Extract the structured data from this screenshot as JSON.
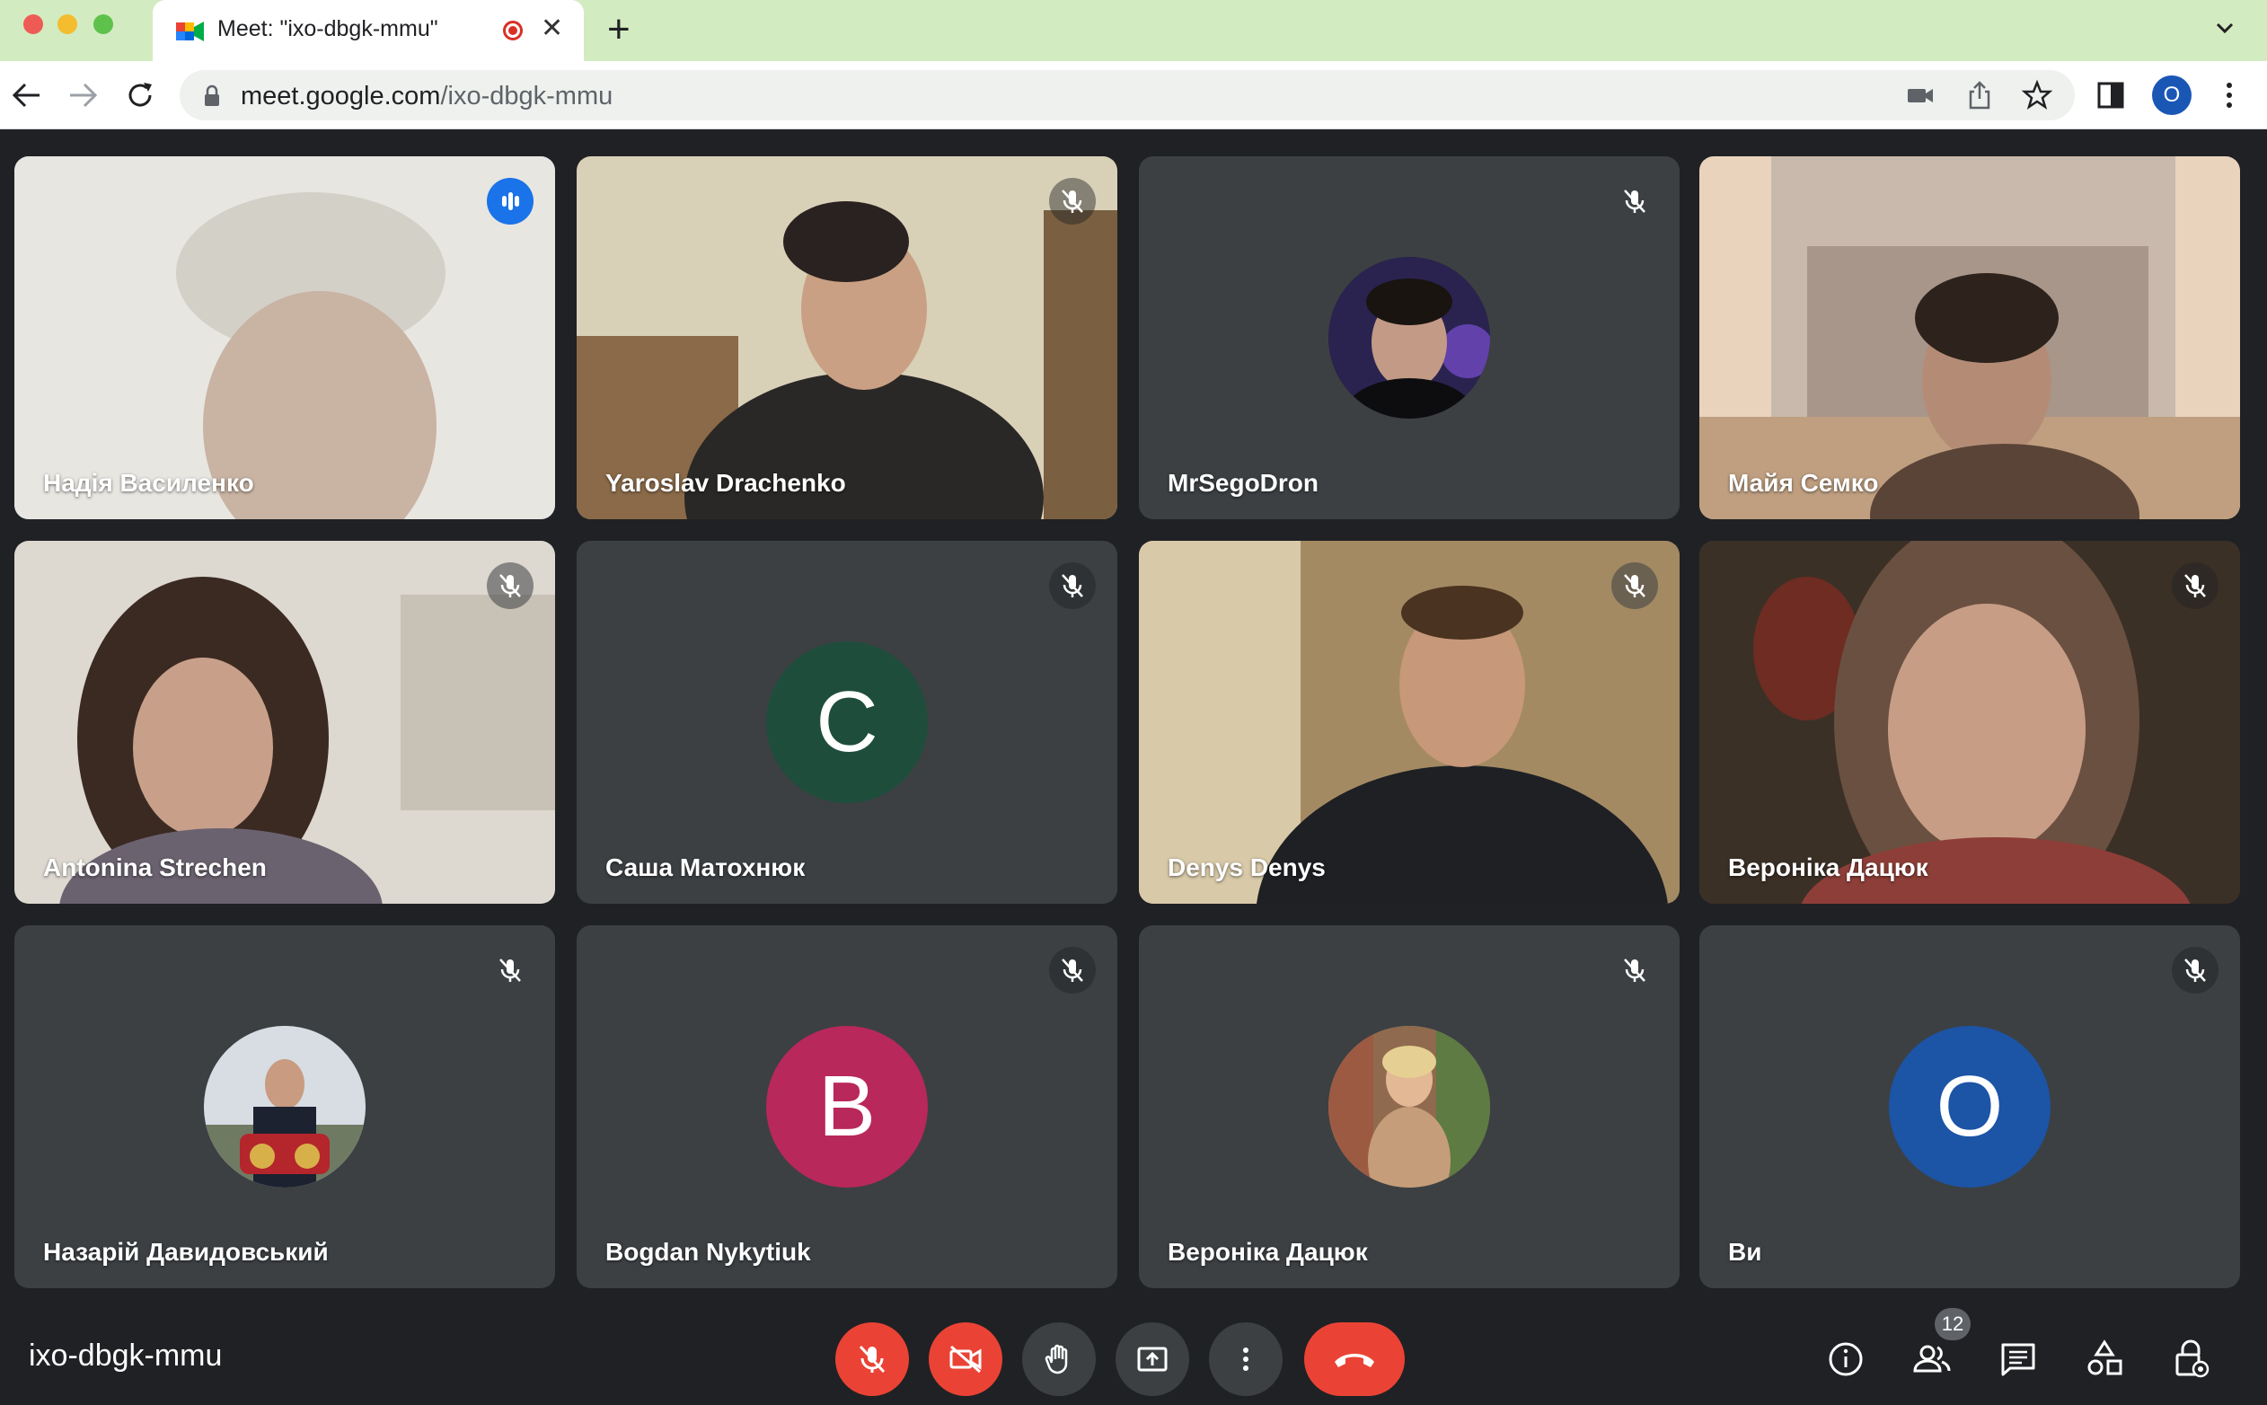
{
  "browser": {
    "tab_title": "Meet: \"ixo-dbgk-mmu\"",
    "close_symbol": "✕",
    "new_tab_symbol": "+",
    "url_host": "meet.google.com",
    "url_path": "/ixo-dbgk-mmu",
    "profile_initial": "O"
  },
  "participants": [
    {
      "name": "Надія Василенко",
      "state": "speaking",
      "view": "video"
    },
    {
      "name": "Yaroslav Drachenko",
      "state": "muted",
      "view": "video"
    },
    {
      "name": "MrSegoDron",
      "state": "muted",
      "view": "avatar-photo"
    },
    {
      "name": "Майя Семко",
      "state": "video",
      "view": "video"
    },
    {
      "name": "Antonina Strechen",
      "state": "muted",
      "view": "video"
    },
    {
      "name": "Саша Матохнюк",
      "state": "muted",
      "view": "avatar-initial",
      "initial": "С",
      "color": "#1e4d3b"
    },
    {
      "name": "Denys Denys",
      "state": "muted",
      "view": "video"
    },
    {
      "name": "Вероніка Дацюк",
      "state": "muted",
      "view": "video"
    },
    {
      "name": "Назарій Давидовський",
      "state": "muted",
      "view": "avatar-photo"
    },
    {
      "name": "Bogdan Nykytiuk",
      "state": "muted",
      "view": "avatar-initial",
      "initial": "B",
      "color": "#b9285a"
    },
    {
      "name": "Вероніка Дацюк",
      "state": "muted",
      "view": "avatar-photo"
    },
    {
      "name": "Ви",
      "state": "muted",
      "view": "avatar-initial",
      "initial": "O",
      "color": "#1c54a6"
    }
  ],
  "meeting": {
    "code": "ixo-dbgk-mmu",
    "people_count": "12"
  },
  "controls": {
    "mic_state": "off",
    "camera_state": "off",
    "end_call_color": "#ea4335"
  },
  "icons": [
    "meet-logo-icon",
    "recording-icon",
    "close-icon",
    "plus-icon",
    "chevron-down-icon",
    "back-icon",
    "forward-icon",
    "reload-icon",
    "lock-icon",
    "camera-blocked-icon",
    "share-icon",
    "star-icon",
    "sidepanel-icon",
    "kebab-icon",
    "mic-off-icon",
    "camera-off-icon",
    "raise-hand-icon",
    "present-icon",
    "more-options-icon",
    "end-call-icon",
    "info-icon",
    "people-icon",
    "chat-icon",
    "activities-icon",
    "host-controls-icon"
  ]
}
